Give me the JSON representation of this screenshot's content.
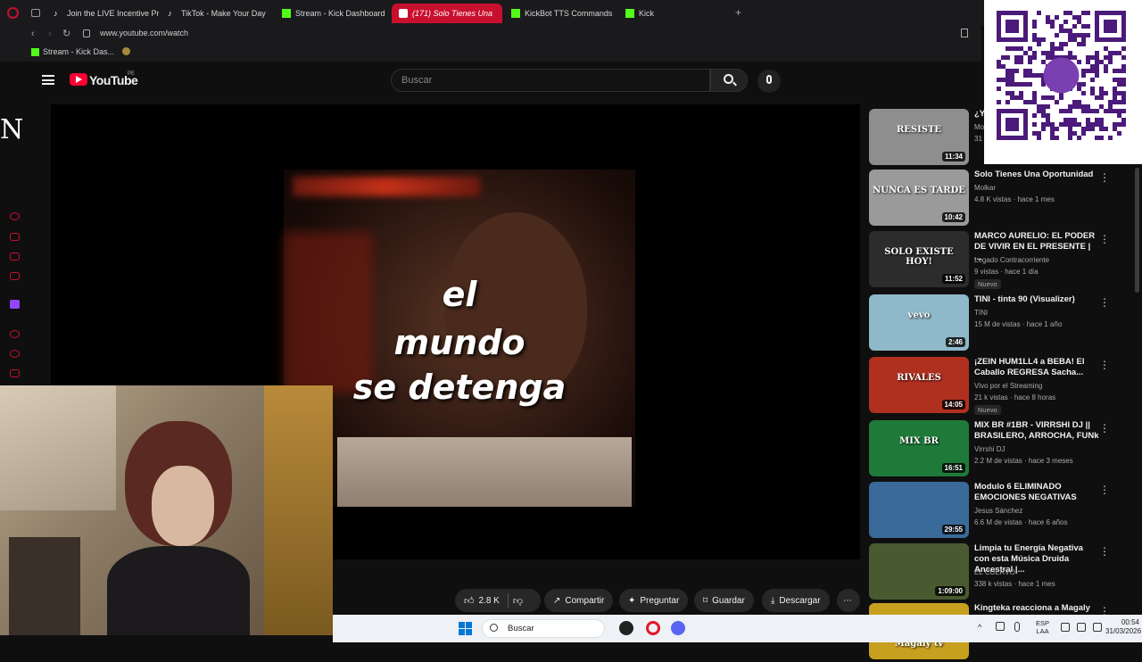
{
  "browser": {
    "tabs": [
      {
        "label": "Join the LIVE Incentive Pro",
        "icon": "tiktok-icon"
      },
      {
        "label": "TikTok - Make Your Day",
        "icon": "tiktok-icon"
      },
      {
        "label": "Stream - Kick Dashboard",
        "icon": "kick-icon"
      },
      {
        "label": "(171) Solo Tienes Una",
        "icon": "youtube-icon"
      },
      {
        "label": "KickBot TTS Commands",
        "icon": "kickbot-icon"
      },
      {
        "label": "Kick",
        "icon": "kick-icon"
      }
    ],
    "url": "www.youtube.com/watch",
    "bookmark": "Stream - Kick Das..."
  },
  "youtube": {
    "logo": "YouTube",
    "region": "PE",
    "search_placeholder": "Buscar"
  },
  "overlay_letter": "N",
  "video": {
    "caption_lines": [
      "el",
      "mundo",
      "se detenga"
    ]
  },
  "actions": {
    "likes": "2.8 K",
    "share": "Compartir",
    "ask": "Preguntar",
    "save": "Guardar",
    "download": "Descargar"
  },
  "recommendations": [
    {
      "title": "¿Y",
      "channel": "Mo",
      "meta": "31",
      "duration": "11:34",
      "thumb_text": "RESISTE",
      "thumb_color": "#8e8e8e"
    },
    {
      "title": "Solo Tienes Una Oportunidad",
      "channel": "Molkar",
      "meta": "4.8 K vistas · hace 1 mes",
      "duration": "10:42",
      "thumb_text": "NUNCA ES TARDE",
      "thumb_color": "#9a9a9a"
    },
    {
      "title": "MARCO AURELIO: EL PODER DE VIVIR EN EL PRESENTE | ...",
      "channel": "Legado Contracorriente",
      "meta": "9 vistas · hace 1 día",
      "duration": "11:52",
      "badge": "Nuevo",
      "thumb_text": "SOLO EXISTE HOY!",
      "thumb_color": "#2c2c2c"
    },
    {
      "title": "TINI - tinta 90 (Visualizer)",
      "channel": "TINI",
      "meta": "15 M de vistas · hace 1 año",
      "duration": "2:46",
      "thumb_text": "vevo",
      "thumb_color": "#8fb8c8"
    },
    {
      "title": "¡ZEIN HUM1LL4 a BEBA! El Caballo REGRESA Sacha...",
      "channel": "Vivo por el Streaming",
      "meta": "21 k vistas · hace 8 horas",
      "duration": "14:05",
      "badge": "Nuevo",
      "thumb_text": "RIVALES",
      "thumb_color": "#b03020"
    },
    {
      "title": "MIX BR #1BR - VIRRSHI DJ || BRASILERO, ARROCHA, FUNk",
      "channel": "Virrshi DJ",
      "meta": "2.2 M de vistas · hace 3 meses",
      "duration": "16:51",
      "thumb_text": "MIX BR",
      "thumb_color": "#1f7a3a"
    },
    {
      "title": "Modulo 6 ELIMINADO EMOCIONES NEGATIVAS",
      "channel": "Jesus Sánchez",
      "meta": "6.6 M de vistas · hace 6 años",
      "duration": "29:55",
      "thumb_text": "",
      "thumb_color": "#3a6a9a"
    },
    {
      "title": "Limpia tu Energía Negativa con esta Música Druida Ancestral |...",
      "channel": "EL CUERVO",
      "meta": "338 k vistas · hace 1 mes",
      "duration": "1:09:00",
      "thumb_text": "",
      "thumb_color": "#4a5a30"
    },
    {
      "title": "Kingteka reacciona a Magaly Tv",
      "channel": "",
      "meta": "",
      "duration": "",
      "thumb_text": "Kingteka reacciona a Magaly tv",
      "thumb_color": "#c8a020"
    }
  ],
  "taskbar": {
    "search": "Buscar",
    "lang1": "ESP",
    "lang2": "LAA",
    "time": "00:54",
    "date": "31/03/2026"
  },
  "colors": {
    "accent": "#c8102e",
    "yt_red": "#ff0033",
    "kick_green": "#53fc18"
  }
}
